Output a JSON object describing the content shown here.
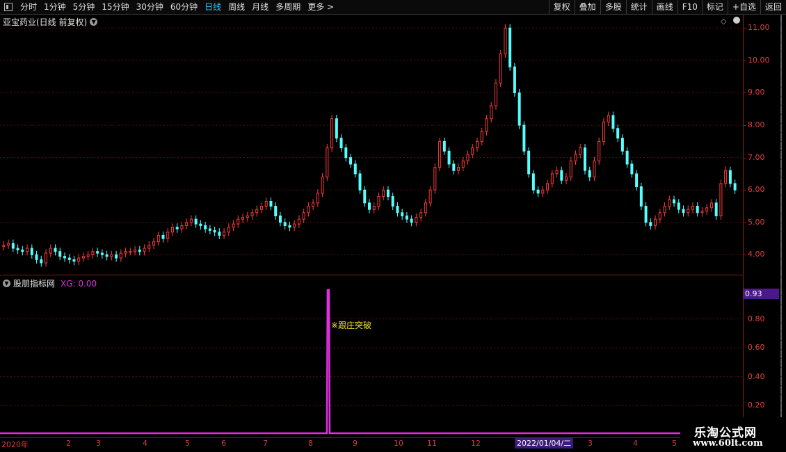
{
  "toolbar": {
    "periods": [
      "分时",
      "1分钟",
      "5分钟",
      "15分钟",
      "30分钟",
      "60分钟",
      "日线",
      "周线",
      "月线",
      "多周期",
      "更多 >"
    ],
    "active_period": "日线",
    "actions": [
      "复权",
      "叠加",
      "多股",
      "统计",
      "画线",
      "F10",
      "标记",
      "+自选",
      "返回"
    ]
  },
  "main_panel": {
    "title": "亚宝药业(日线 前复权)",
    "price_axis": [
      "11.00",
      "10.00",
      "9.00",
      "8.00",
      "7.00",
      "6.00",
      "5.00",
      "4.00"
    ]
  },
  "sub_panel": {
    "title": "股朋指标网",
    "indicator": "XG: 0.00",
    "signal_text": "※跟庄突破",
    "axis": [
      "0.80",
      "0.60",
      "0.40",
      "0.20"
    ],
    "current_value": "0.93"
  },
  "time_axis": {
    "labels": [
      "2020年",
      "2",
      "3",
      "4",
      "5",
      "6",
      "7",
      "8",
      "9",
      "10",
      "11",
      "12",
      "3",
      "4",
      "5"
    ],
    "highlight": "2022/01/04/二"
  },
  "watermark": {
    "title": "乐淘公式网",
    "url": "www.60lt.com"
  },
  "colors": {
    "up": "#ff3b3b",
    "down": "#54ffff",
    "indicator": "#e030e0",
    "signal": "#f0e020"
  },
  "chart_data": {
    "type": "candlestick",
    "ylim": [
      3.6,
      11.2
    ],
    "close": [
      4.3,
      4.35,
      4.2,
      4.15,
      4.1,
      4.2,
      4.0,
      3.85,
      3.75,
      4.05,
      4.2,
      4.1,
      3.95,
      3.9,
      3.85,
      3.8,
      3.9,
      3.95,
      4.0,
      4.1,
      4.05,
      4.0,
      3.95,
      4.0,
      3.9,
      4.05,
      4.1,
      4.1,
      4.15,
      4.1,
      4.2,
      4.3,
      4.4,
      4.6,
      4.5,
      4.7,
      4.85,
      4.8,
      4.9,
      5.0,
      5.1,
      4.95,
      4.9,
      4.8,
      4.75,
      4.7,
      4.6,
      4.7,
      4.85,
      4.95,
      5.1,
      5.15,
      5.2,
      5.3,
      5.4,
      5.5,
      5.65,
      5.5,
      5.2,
      5.0,
      4.9,
      4.85,
      4.95,
      5.1,
      5.3,
      5.5,
      5.6,
      5.9,
      6.4,
      7.3,
      8.2,
      7.6,
      7.3,
      7.0,
      6.8,
      6.5,
      6.0,
      5.6,
      5.4,
      5.5,
      5.8,
      6.0,
      5.8,
      5.5,
      5.3,
      5.2,
      5.1,
      5.0,
      5.15,
      5.3,
      5.6,
      6.0,
      6.7,
      7.5,
      7.2,
      6.8,
      6.6,
      6.7,
      6.9,
      7.1,
      7.3,
      7.5,
      7.8,
      8.2,
      8.6,
      9.3,
      10.2,
      11.0,
      9.8,
      9.0,
      8.0,
      7.2,
      6.5,
      6.0,
      5.9,
      6.0,
      6.2,
      6.5,
      6.6,
      6.3,
      6.4,
      6.9,
      7.1,
      7.3,
      6.6,
      6.4,
      6.9,
      7.5,
      8.1,
      8.3,
      7.9,
      7.6,
      7.2,
      6.8,
      6.5,
      6.1,
      5.5,
      5.0,
      4.9,
      5.1,
      5.3,
      5.5,
      5.7,
      5.6,
      5.4,
      5.3,
      5.4,
      5.5,
      5.3,
      5.35,
      5.45,
      5.6,
      5.2,
      6.2,
      6.6,
      6.2,
      6.0
    ],
    "signal": {
      "index": 0.44,
      "value": 1.0
    },
    "indicator_ylim": [
      0,
      1.0
    ]
  }
}
